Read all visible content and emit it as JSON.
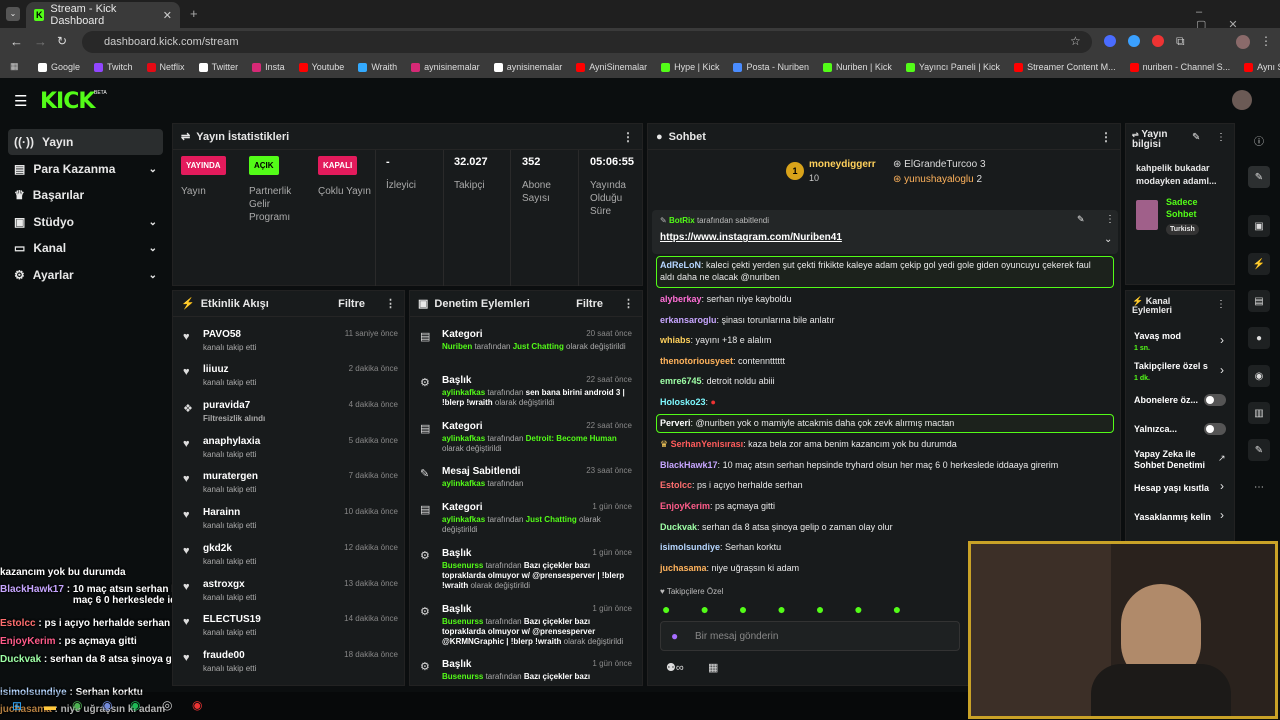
{
  "browser": {
    "tab_title": "Stream - Kick Dashboard",
    "url": "dashboard.kick.com/stream",
    "bookmarks": [
      "Google",
      "Twitch",
      "Netflix",
      "Twitter",
      "Insta",
      "Youtube",
      "Wraith",
      "aynisinemalar",
      "aynisinemalar",
      "AyniSinemalar",
      "Hype | Kick",
      "Posta - Nuriben",
      "Nuriben | Kick",
      "Yayıncı Paneli | Kick",
      "Streamer Content M...",
      "nuriben - Channel S...",
      "Aynı Sinemalar - Ça..."
    ]
  },
  "logo": "KICK",
  "logo_beta": "BETA",
  "sidebar": {
    "items": [
      {
        "label": "Yayın"
      },
      {
        "label": "Para Kazanma"
      },
      {
        "label": "Başarılar"
      },
      {
        "label": "Stüdyo"
      },
      {
        "label": "Kanal"
      },
      {
        "label": "Ayarlar"
      }
    ]
  },
  "stats": {
    "title": "Yayın İstatistikleri",
    "items": [
      {
        "badge": "YAYINDA",
        "label": "Yayın"
      },
      {
        "badge": "AÇIK",
        "label": "Partnerlik Gelir Programı"
      },
      {
        "badge": "KAPALI",
        "label": "Çoklu Yayın"
      },
      {
        "value": "-",
        "label": "İzleyici"
      },
      {
        "value": "32.027",
        "label": "Takipçi"
      },
      {
        "value": "352",
        "label": "Abone Sayısı"
      },
      {
        "value": "05:06:55",
        "label": "Yayında Olduğu Süre"
      }
    ]
  },
  "activity": {
    "title": "Etkinlik Akışı",
    "filter": "Filtre",
    "rows": [
      {
        "name": "PAVO58",
        "sub": "kanalı takip etti",
        "time": "11 saniye önce"
      },
      {
        "name": "liiuuz",
        "sub": "kanalı takip etti",
        "time": "2 dakika önce"
      },
      {
        "name": "puravida7",
        "sub": "Filtresizlik alındı",
        "time": "4 dakika önce"
      },
      {
        "name": "anaphylaxia",
        "sub": "kanalı takip etti",
        "time": "5 dakika önce"
      },
      {
        "name": "muratergen",
        "sub": "kanalı takip etti",
        "time": "7 dakika önce"
      },
      {
        "name": "Harainn",
        "sub": "kanalı takip etti",
        "time": "10 dakika önce"
      },
      {
        "name": "gkd2k",
        "sub": "kanalı takip etti",
        "time": "12 dakika önce"
      },
      {
        "name": "astroxgx",
        "sub": "kanalı takip etti",
        "time": "13 dakika önce"
      },
      {
        "name": "ELECTUS19",
        "sub": "kanalı takip etti",
        "time": "14 dakika önce"
      },
      {
        "name": "fraude00",
        "sub": "kanalı takip etti",
        "time": "18 dakika önce"
      }
    ]
  },
  "moderation": {
    "title": "Denetim Eylemleri",
    "filter": "Filtre",
    "rows": [
      {
        "name": "Kategori",
        "time": "20 saat önce",
        "user": "Nuriben",
        "mid": " tarafından ",
        "val": "Just Chatting",
        "end": " olarak değiştirildi"
      },
      {
        "name": "Başlık",
        "time": "22 saat önce",
        "user": "aylinkafkas",
        "mid": " tarafından ",
        "val": "sen bana birini android 3 | !blerp !wraith",
        "end": " olarak değiştirildi"
      },
      {
        "name": "Kategori",
        "time": "22 saat önce",
        "user": "aylinkafkas",
        "mid": " tarafından ",
        "val": "Detroit: Become Human",
        "end": " olarak değiştirildi"
      },
      {
        "name": "Mesaj Sabitlendi",
        "time": "23 saat önce",
        "user": "aylinkafkas",
        "mid": " tarafından",
        "val": "",
        "end": ""
      },
      {
        "name": "Kategori",
        "time": "1 gün önce",
        "user": "aylinkafkas",
        "mid": " tarafından ",
        "val": "Just Chatting",
        "end": " olarak değiştirildi"
      },
      {
        "name": "Başlık",
        "time": "1 gün önce",
        "user": "Busenurss",
        "mid": " tarafından ",
        "val": "Bazı çiçekler bazı topraklarda olmuyor w/ @prensesperver | !blerp !wraith",
        "end": " olarak değiştirildi"
      },
      {
        "name": "Başlık",
        "time": "1 gün önce",
        "user": "Busenurss",
        "mid": " tarafından ",
        "val": "Bazı çiçekler bazı topraklarda olmuyor w/ @prensesperver @KRMNGraphic | !blerp !wraith",
        "end": " olarak değiştirildi"
      },
      {
        "name": "Başlık",
        "time": "1 gün önce",
        "user": "Busenurss",
        "mid": " tarafından ",
        "val": "Bazı çiçekler bazı",
        "end": ""
      }
    ]
  },
  "chat": {
    "title": "Sohbet",
    "leaders": [
      {
        "rank": "1",
        "name": "moneydiggerr",
        "count": "10"
      },
      {
        "name": "ElGrandeTurcoo",
        "count": "3"
      },
      {
        "name": "yunushayaloglu",
        "count": "2"
      }
    ],
    "pinned": {
      "by": "BotRix",
      "suffix": " tarafından sabitlendi",
      "link": "https://www.instagram.com/Nuriben41"
    },
    "messages": [
      {
        "user": "AdReLoN",
        "color": "#b6d6ff",
        "text": "kaleci çekti yerden şut çekti frikikte kaleye adam çekip gol yedi gole giden oyuncuyu çekerek faul aldı daha ne olacak @nuriben",
        "hl": true
      },
      {
        "user": "alyberkay",
        "color": "#ff6fd6",
        "text": "serhan niye kayboldu"
      },
      {
        "user": "erkansaroglu",
        "color": "#c7a6ff",
        "text": "şinası torunlarına bile anlatır"
      },
      {
        "user": "whiabs",
        "color": "#ffd15c",
        "text": "yayını +18 e alalım"
      },
      {
        "user": "thenotoriousyeet",
        "color": "#ffb35c",
        "text": "contenntttttt"
      },
      {
        "user": "emre6745",
        "color": "#9effa6",
        "text": "detroit noldu abiii"
      },
      {
        "user": "Holosko23",
        "color": "#7ef9ff",
        "text": ""
      },
      {
        "user": "Perveri",
        "color": "#ffffff",
        "text": "@nuriben yok o mamiyle atcakmis daha çok zevk alırmış mactan",
        "hl": true
      },
      {
        "user": "SerhanYenisırası",
        "color": "#ff5c5c",
        "text": "kaza bela zor ama benim kazancım yok bu durumda"
      },
      {
        "user": "BlackHawk17",
        "color": "#c7a6ff",
        "text": "10 maç atsın serhan hepsinde tryhard olsun her maç 6 0 herkeslede iddaaya girerim"
      },
      {
        "user": "Estolcc",
        "color": "#ff6f6f",
        "text": "ps i açıyo herhalde serhan"
      },
      {
        "user": "EnjoyKerim",
        "color": "#ff5c8a",
        "text": "ps açmaya gitti"
      },
      {
        "user": "Duckvak",
        "color": "#9effa6",
        "text": "serhan da 8 atsa şinoya gelip o zaman olay olur"
      },
      {
        "user": "isimolsundiye",
        "color": "#b6d6ff",
        "text": "Serhan korktu"
      },
      {
        "user": "juchasama",
        "color": "#ffb35c",
        "text": "niye uğraşsın ki adam"
      }
    ],
    "followers_only": "Takipçilere Özel",
    "input_placeholder": "Bir mesaj gönderin"
  },
  "stream_info": {
    "title": "Yayın bilgisi",
    "stream_title": "kahpelik bukadar modayken adaml...",
    "category": "Sadece Sohbet",
    "tag": "Turkish"
  },
  "channel_actions": {
    "title": "Kanal Eylemleri",
    "items": [
      {
        "label": "Yavaş mod",
        "sub": "1 sn."
      },
      {
        "label": "Takipçilere özel s",
        "sub": "1 dk."
      },
      {
        "label": "Abonelere öz..."
      },
      {
        "label": "Yalnızca..."
      },
      {
        "label": "Yapay Zeka ile Sohbet Denetimi"
      },
      {
        "label": "Hesap yaşı kısıtla"
      },
      {
        "label": "Yasaklanmış kelin"
      }
    ]
  },
  "overlay_chat": [
    {
      "user": "",
      "text": "kazancım yok bu durumda",
      "color": "#ffffff"
    },
    {
      "user": "BlackHawk17",
      "text": "10 maç atsın serhan hepsinde tryhard olsun her maç 6 0 herkeslede iddaaya girerim",
      "color": "#c7a6ff"
    },
    {
      "user": "Estolcc",
      "text": "ps i açıyo herhalde serhan",
      "color": "#ff6f6f"
    },
    {
      "user": "EnjoyKerim",
      "text": "ps açmaya gitti",
      "color": "#ff5c8a"
    },
    {
      "user": "Duckvak",
      "text": "serhan da 8 atsa şinoya gelip o zaman olay olur",
      "color": "#9effa6"
    },
    {
      "user": "isimolsundiye",
      "text": "Serhan korktu",
      "color": "#b6d6ff"
    },
    {
      "user": "juchasama",
      "text": "niye uğraşsın ki adam",
      "color": "#ffb35c"
    }
  ],
  "colors": {
    "accent": "#53fc18",
    "live": "#e31b5c"
  }
}
